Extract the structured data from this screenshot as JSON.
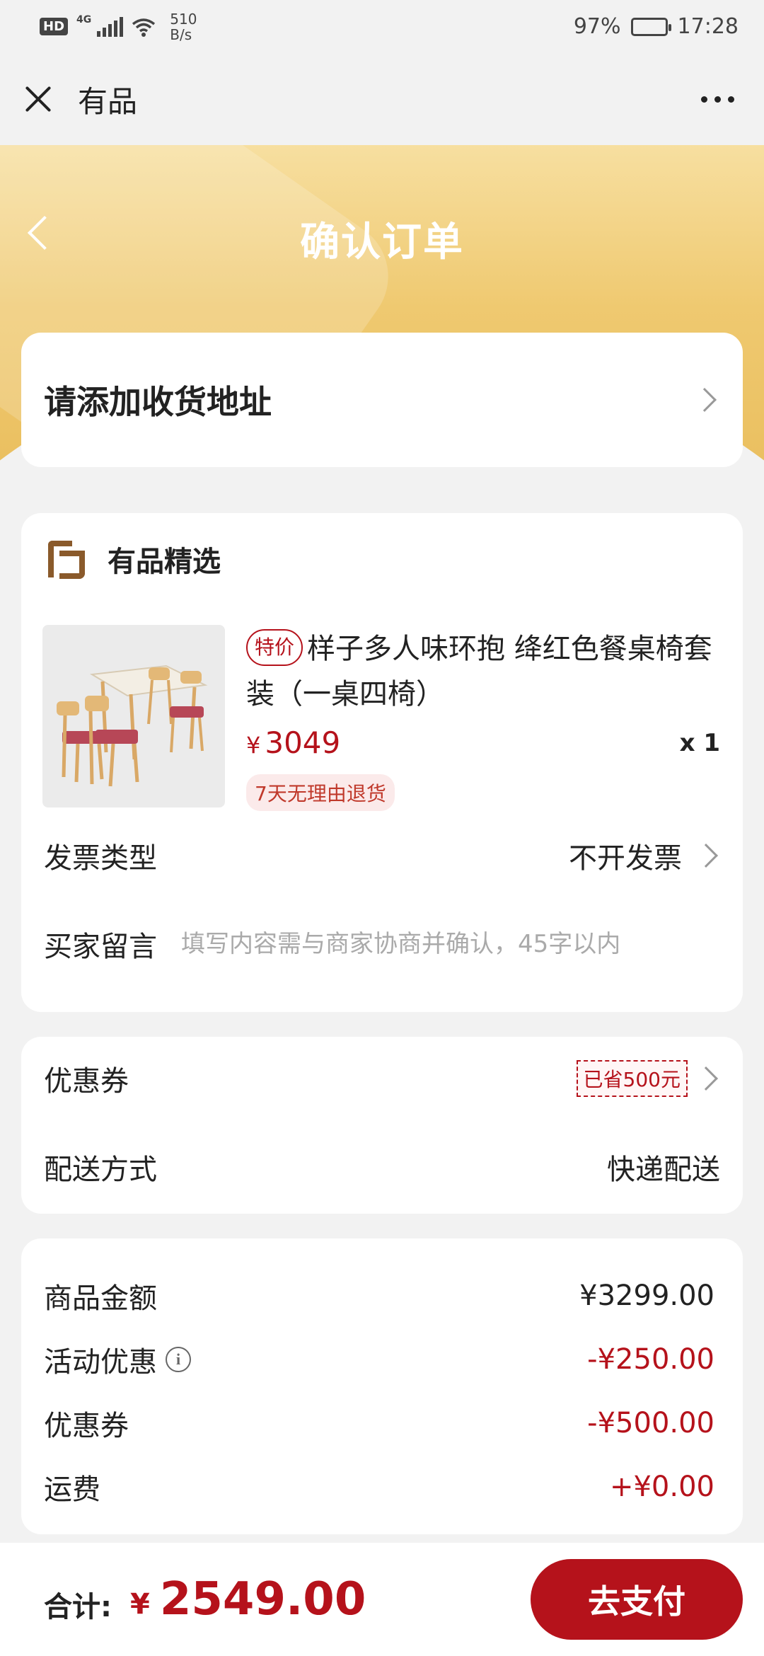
{
  "status_bar": {
    "hd": "HD",
    "network": "4G",
    "speed_value": "510",
    "speed_unit": "B/s",
    "battery": "97%",
    "time": "17:28",
    "icons": [
      "signal-icon",
      "wifi-icon",
      "battery-icon"
    ]
  },
  "app_bar": {
    "title": "有品"
  },
  "header": {
    "title": "确认订单"
  },
  "address": {
    "label": "请添加收货地址"
  },
  "shop": {
    "name": "有品精选",
    "product": {
      "tag": "特价",
      "title": "样子多人味环抱 绛红色餐桌椅套装（一桌四椅）",
      "price_symbol": "¥",
      "price": "3049",
      "quantity": "x 1",
      "return_policy": "7天无理由退货"
    },
    "invoice": {
      "label": "发票类型",
      "value": "不开发票"
    },
    "message": {
      "label": "买家留言",
      "placeholder": "填写内容需与商家协商并确认，45字以内"
    }
  },
  "coupon_section": {
    "coupon_label": "优惠券",
    "coupon_badge": "已省500元",
    "delivery_label": "配送方式",
    "delivery_value": "快递配送"
  },
  "summary": {
    "rows": [
      {
        "label": "商品金额",
        "value": "¥3299.00"
      },
      {
        "label": "活动优惠",
        "value": "-¥250.00"
      },
      {
        "label": "优惠券",
        "value": "-¥500.00"
      },
      {
        "label": "运费",
        "value": "+¥0.00"
      }
    ]
  },
  "footer": {
    "total_label": "合计:",
    "total_symbol": "¥",
    "total_value": "2549.00",
    "pay_button": "去支付"
  },
  "colors": {
    "accent_red": "#b5121b",
    "banner_gold": "#efc970",
    "background": "#f2f2f2"
  }
}
